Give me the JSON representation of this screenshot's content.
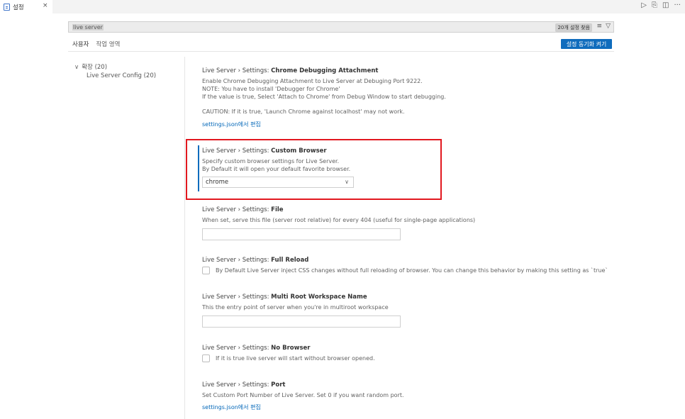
{
  "tab": {
    "title": "설정",
    "close": "×",
    "icon": "file-icon"
  },
  "tab_actions": [
    "▷",
    "⎘",
    "◫",
    "···"
  ],
  "search": {
    "value": "live server",
    "count": "20개 설정 찾음",
    "clear_icon": "≡",
    "filter_icon": "▽"
  },
  "scope": {
    "user": "사용자",
    "workspace": "작업 영역"
  },
  "sync_button": "설정 동기화 켜기",
  "tree": {
    "extensions": "확장 (20)",
    "chevron": "∨",
    "item": "Live Server Config (20)"
  },
  "settings": {
    "chrome": {
      "prefix": "Live Server › Settings: ",
      "name": "Chrome Debugging Attachment",
      "desc1": "Enable Chrome Debugging Attachment to Live Server at Debuging Port 9222.",
      "desc2": "NOTE: You have to install 'Debugger for Chrome'",
      "desc3": "If the value is true, Select 'Attach to Chrome' from Debug Window to start debugging.",
      "desc4": "CAUTION: If it is true, 'Launch Chrome against localhost' may not work.",
      "link": "settings.json에서 편집"
    },
    "browser": {
      "prefix": "Live Server › Settings: ",
      "name": "Custom Browser",
      "desc1": "Specify custom browser settings for Live Server.",
      "desc2": "By Default it will open your default favorite browser.",
      "value": "chrome",
      "chevron": "∨"
    },
    "file": {
      "prefix": "Live Server › Settings: ",
      "name": "File",
      "desc": "When set, serve this file (server root relative) for every 404 (useful for single-page applications)"
    },
    "reload": {
      "prefix": "Live Server › Settings: ",
      "name": "Full Reload",
      "desc": "By Default Live Server inject CSS changes without full reloading of browser. You can change this behavior by making this setting as `true`"
    },
    "multiroot": {
      "prefix": "Live Server › Settings: ",
      "name": "Multi Root Workspace Name",
      "desc": "This the entry point of server when you're in multiroot workspace"
    },
    "nobrowser": {
      "prefix": "Live Server › Settings: ",
      "name": "No Browser",
      "desc": "If it is true live server will start without browser opened."
    },
    "port": {
      "prefix": "Live Server › Settings: ",
      "name": "Port",
      "desc": "Set Custom Port Number of Live Server. Set 0 if you want random port.",
      "link": "settings.json에서 편집"
    }
  },
  "colors": {
    "accent": "#0f6cbd",
    "highlight": "#e2181f",
    "link": "#0066b8"
  }
}
